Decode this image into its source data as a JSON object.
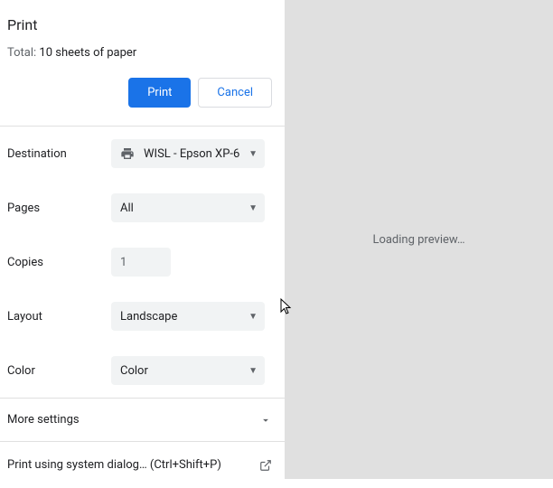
{
  "header": {
    "title": "Print",
    "total_prefix": "Total: ",
    "total_count": "10 sheets of paper"
  },
  "buttons": {
    "print": "Print",
    "cancel": "Cancel"
  },
  "settings": {
    "destination": {
      "label": "Destination",
      "value": "WISL - Epson XP-6",
      "icon": "printer-icon"
    },
    "pages": {
      "label": "Pages",
      "value": "All"
    },
    "copies": {
      "label": "Copies",
      "value": "1"
    },
    "layout": {
      "label": "Layout",
      "value": "Landscape"
    },
    "color": {
      "label": "Color",
      "value": "Color"
    }
  },
  "more_settings": {
    "label": "More settings"
  },
  "system_dialog": {
    "label": "Print using system dialog…",
    "shortcut": "(Ctrl+Shift+P)"
  },
  "preview": {
    "loading_text": "Loading preview…"
  }
}
